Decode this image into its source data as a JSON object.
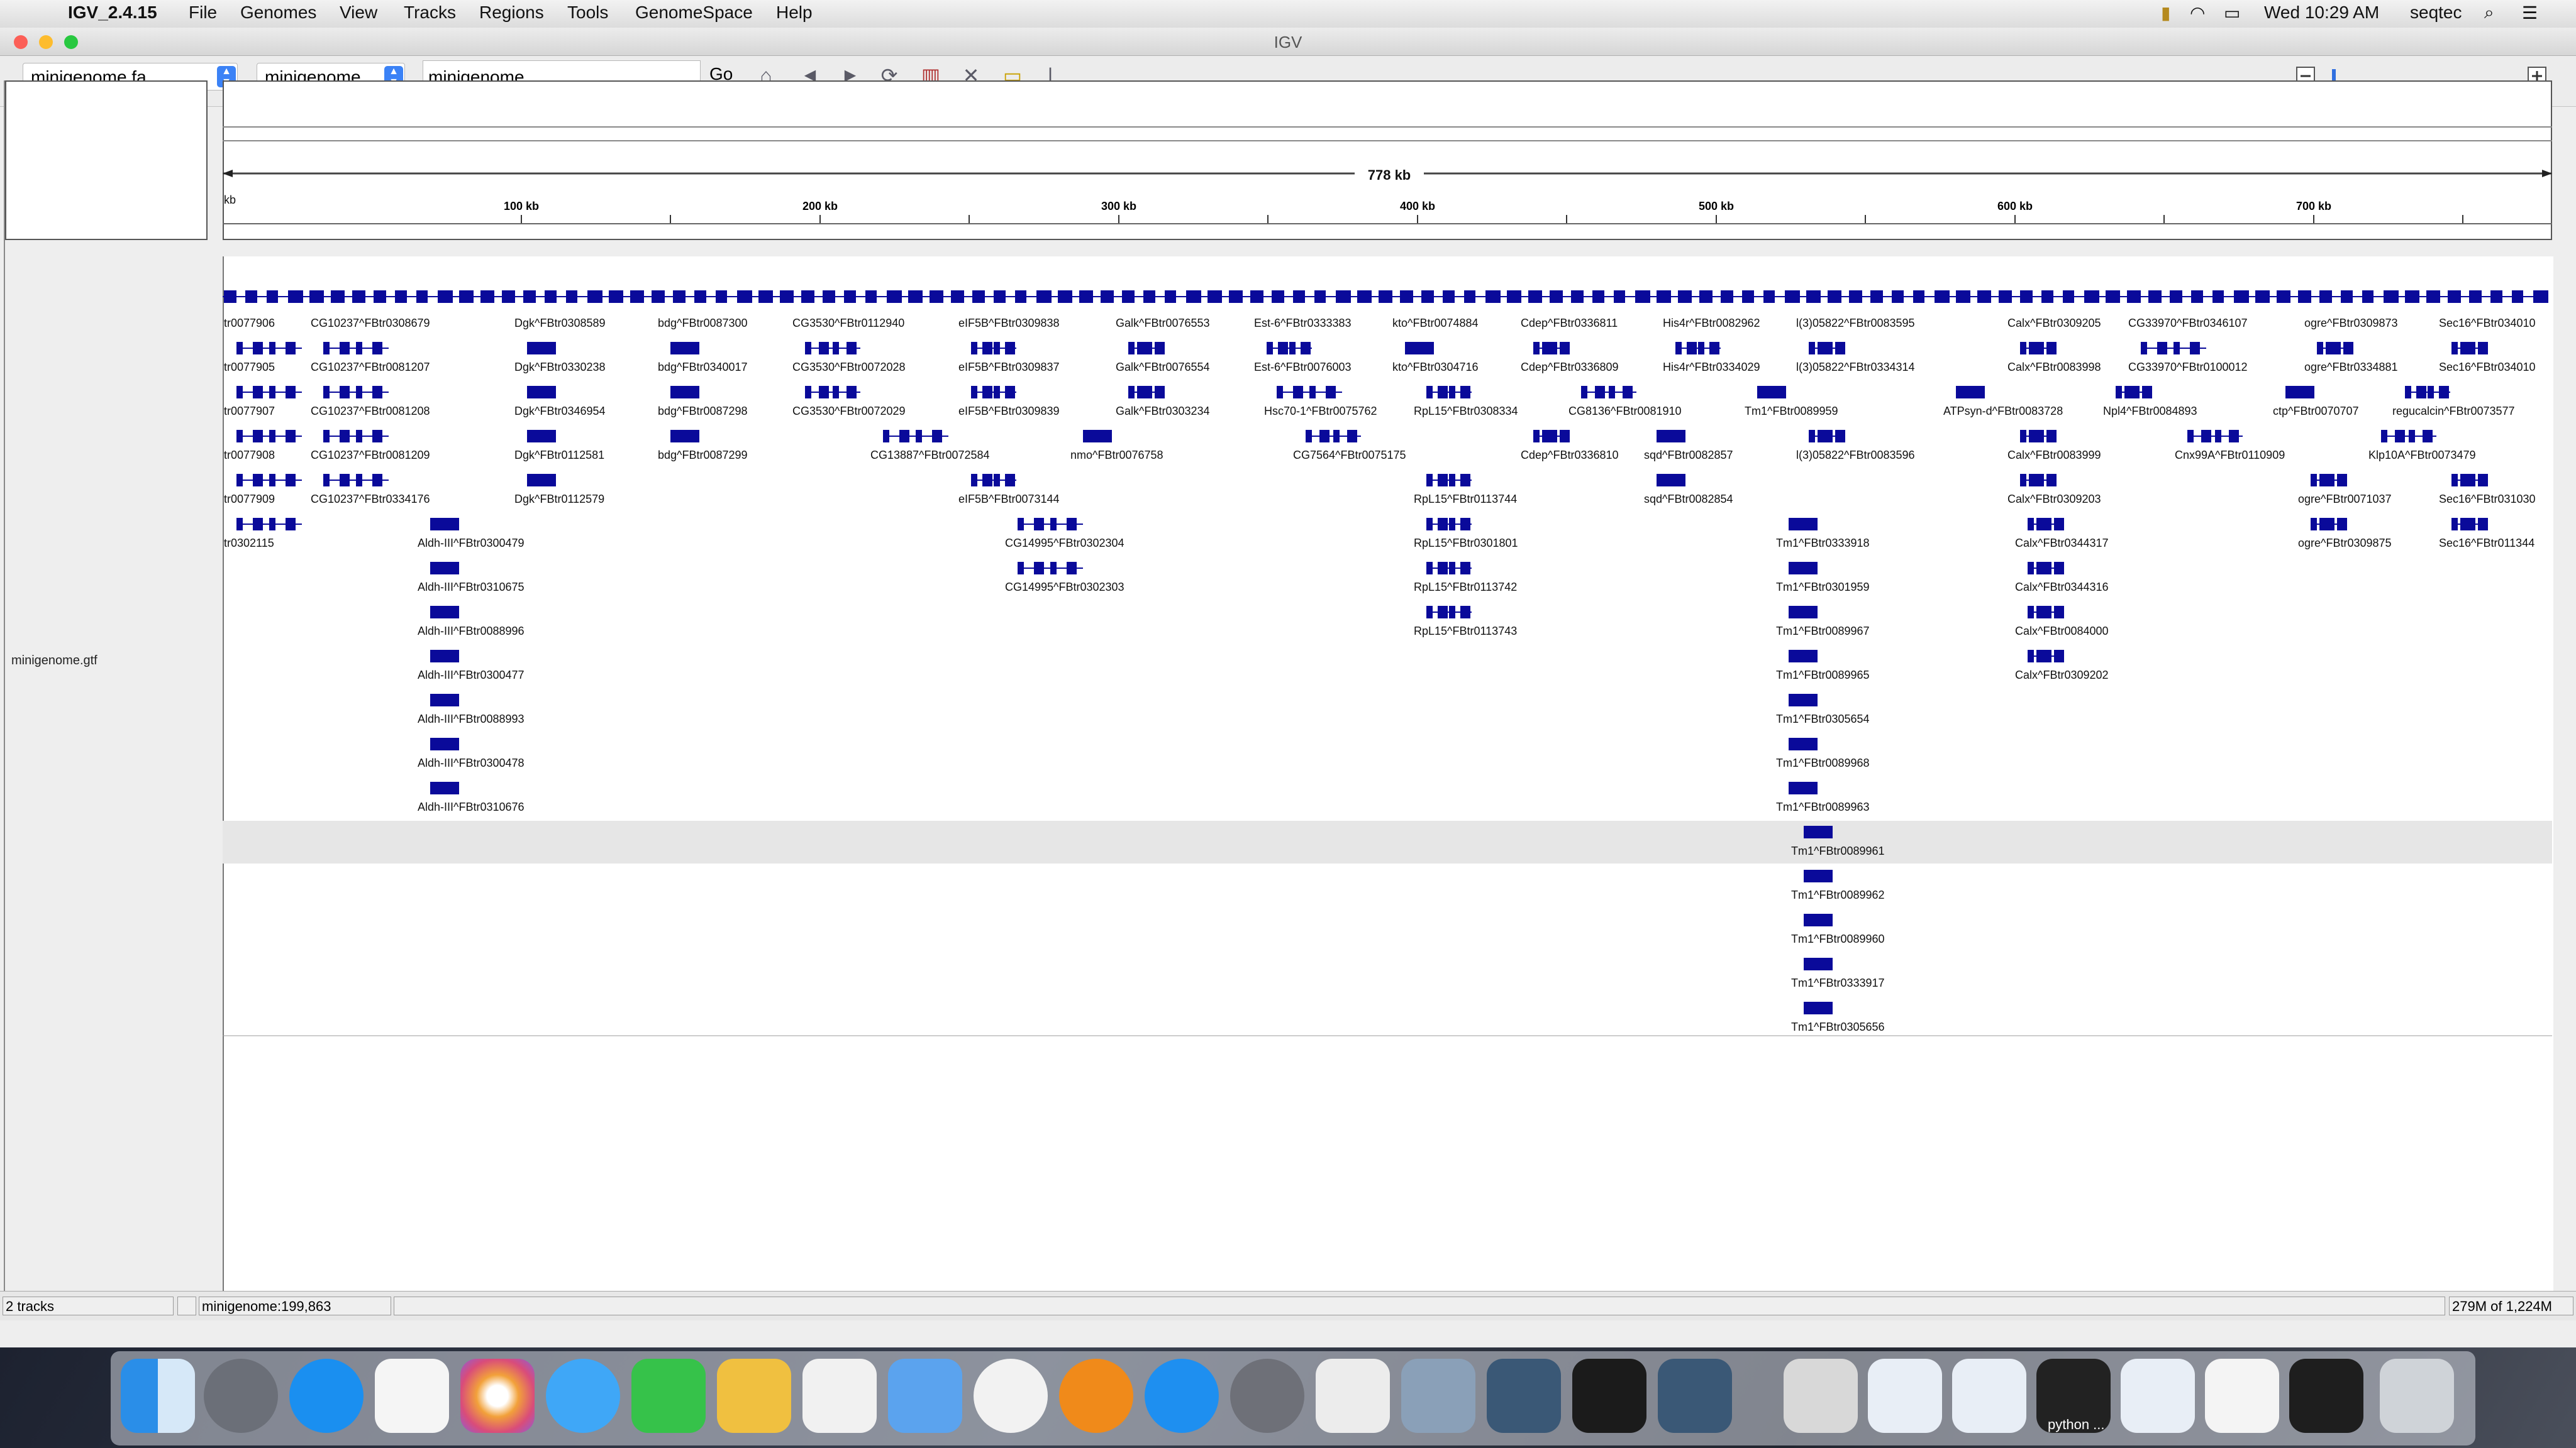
{
  "menubar": {
    "app": "IGV_2.4.15",
    "items": [
      "File",
      "Genomes",
      "View",
      "Tracks",
      "Regions",
      "Tools",
      "GenomeSpace",
      "Help"
    ],
    "clock": "Wed 10:29 AM",
    "user": "seqtec"
  },
  "window": {
    "title": "IGV"
  },
  "toolbar": {
    "genome_select": "minigenome.fa",
    "chrom_select": "minigenome",
    "locus": "minigenome",
    "go_label": "Go"
  },
  "ruler": {
    "span_label": "778 kb",
    "left_edge_label": "kb",
    "ticks": [
      "100 kb",
      "200 kb",
      "300 kb",
      "400 kb",
      "500 kb",
      "600 kb",
      "700 kb"
    ]
  },
  "track": {
    "name": "minigenome.gtf"
  },
  "features": {
    "rows": [
      [
        "tr0077906",
        "CG10237^FBtr0308679",
        "Dgk^FBtr0308589",
        "bdg^FBtr0087300",
        "CG3530^FBtr0112940",
        "eIF5B^FBtr0309838",
        "Galk^FBtr0076553",
        "Est-6^FBtr0333383",
        "kto^FBtr0074884",
        "Cdep^FBtr0336811",
        "His4r^FBtr0082962",
        "l(3)05822^FBtr0083595",
        "Calx^FBtr0309205",
        "CG33970^FBtr0346107",
        "ogre^FBtr0309873",
        "Sec16^FBtr034010"
      ],
      [
        "tr0077905",
        "CG10237^FBtr0081207",
        "Dgk^FBtr0330238",
        "bdg^FBtr0340017",
        "CG3530^FBtr0072028",
        "eIF5B^FBtr0309837",
        "Galk^FBtr0076554",
        "Est-6^FBtr0076003",
        "kto^FBtr0304716",
        "Cdep^FBtr0336809",
        "His4r^FBtr0334029",
        "l(3)05822^FBtr0334314",
        "Calx^FBtr0083998",
        "CG33970^FBtr0100012",
        "ogre^FBtr0334881",
        "Sec16^FBtr034010"
      ],
      [
        "tr0077907",
        "CG10237^FBtr0081208",
        "Dgk^FBtr0346954",
        "bdg^FBtr0087298",
        "CG3530^FBtr0072029",
        "eIF5B^FBtr0309839",
        "Galk^FBtr0303234",
        "Hsc70-1^FBtr0075762",
        "RpL15^FBtr0308334",
        "CG8136^FBtr0081910",
        "Tm1^FBtr0089959",
        "ATPsyn-d^FBtr0083728",
        "Npl4^FBtr0084893",
        "ctp^FBtr0070707",
        "regucalcin^FBtr0073577"
      ],
      [
        "tr0077908",
        "CG10237^FBtr0081209",
        "Dgk^FBtr0112581",
        "bdg^FBtr0087299",
        "CG13887^FBtr0072584",
        "nmo^FBtr0076758",
        "CG7564^FBtr0075175",
        "Cdep^FBtr0336810",
        "sqd^FBtr0082857",
        "l(3)05822^FBtr0083596",
        "Calx^FBtr0083999",
        "Cnx99A^FBtr0110909",
        "Klp10A^FBtr0073479"
      ],
      [
        "tr0077909",
        "CG10237^FBtr0334176",
        "Dgk^FBtr0112579",
        "eIF5B^FBtr0073144",
        "RpL15^FBtr0113744",
        "sqd^FBtr0082854",
        "Calx^FBtr0309203",
        "ogre^FBtr0071037",
        "Sec16^FBtr031030"
      ],
      [
        "tr0302115",
        "Aldh-III^FBtr0300479",
        "CG14995^FBtr0302304",
        "RpL15^FBtr0301801",
        "Tm1^FBtr0333918",
        "Calx^FBtr0344317",
        "ogre^FBtr0309875",
        "Sec16^FBtr011344"
      ],
      [
        "Aldh-III^FBtr0310675",
        "CG14995^FBtr0302303",
        "RpL15^FBtr0113742",
        "Tm1^FBtr0301959",
        "Calx^FBtr0344316"
      ],
      [
        "Aldh-III^FBtr0088996",
        "RpL15^FBtr0113743",
        "Tm1^FBtr0089967",
        "Calx^FBtr0084000"
      ],
      [
        "Aldh-III^FBtr0300477",
        "Tm1^FBtr0089965",
        "Calx^FBtr0309202"
      ],
      [
        "Aldh-III^FBtr0088993",
        "Tm1^FBtr0305654"
      ],
      [
        "Aldh-III^FBtr0300478",
        "Tm1^FBtr0089968"
      ],
      [
        "Aldh-III^FBtr0310676",
        "Tm1^FBtr0089963"
      ],
      [
        "Tm1^FBtr0089961"
      ],
      [
        "Tm1^FBtr0089962"
      ],
      [
        "Tm1^FBtr0089960"
      ],
      [
        "Tm1^FBtr0333917"
      ],
      [
        "Tm1^FBtr0305656"
      ]
    ]
  },
  "status": {
    "tracks": "2 tracks",
    "position": "minigenome:199,863",
    "memory": "279M of 1,224M"
  },
  "dock": {
    "python_label": "python ..."
  },
  "colors": {
    "feature": "#0a0a9a",
    "track_bg": "#c8c8c8"
  }
}
